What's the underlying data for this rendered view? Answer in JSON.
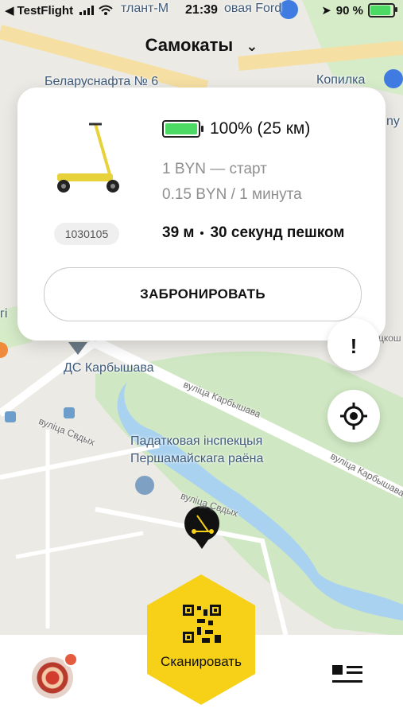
{
  "status_bar": {
    "back_app": "TestFlight",
    "time": "21:39",
    "battery_percent": "90 %",
    "battery_level": 0.9
  },
  "map": {
    "labels": {
      "top_partial_1": "тлант-М",
      "top_partial_2": "овая Ford",
      "belaruskafta": "Беларуснафта № 6",
      "kopilka": "Копилка",
      "my": "ny",
      "hi": "гі",
      "dkshko": "цкош",
      "ds_karbysheva": "ДС Карбышава",
      "street_karbysheva_1": "вуліца Карбышава",
      "street_karbysheva_2": "вуліца Карбышава",
      "street_svdykh_1": "вуліца Свдых",
      "street_svdykh_2": "вуліца Свдых",
      "tax_line1": "Падатковая інспекцыя",
      "tax_line2": "Першамайскага раёна"
    }
  },
  "header": {
    "category": "Самокаты"
  },
  "vehicle_card": {
    "battery_text": "100% (25 км)",
    "battery_level": 1.0,
    "price_start": "1 BYN — старт",
    "price_minute": "0.15 BYN / 1 минута",
    "distance": "39 м",
    "walk_time": "30 секунд пешком",
    "vehicle_id": "1030105",
    "reserve_label": "ЗАБРОНИРОВАТЬ"
  },
  "bottom_bar": {
    "scan_label": "Сканировать"
  },
  "colors": {
    "accent_yellow": "#f7d117",
    "battery_green": "#4cd964",
    "park_green": "#cfe7c2",
    "water": "#a9d2f0"
  }
}
